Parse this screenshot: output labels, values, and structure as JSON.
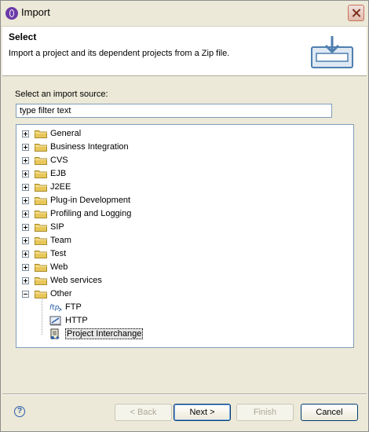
{
  "window": {
    "title": "Import"
  },
  "banner": {
    "heading": "Select",
    "description": "Import a project and its dependent projects from a Zip file."
  },
  "source": {
    "label": "Select an import source:",
    "filter_value": "type filter text"
  },
  "tree": {
    "items": [
      {
        "label": "General"
      },
      {
        "label": "Business Integration"
      },
      {
        "label": "CVS"
      },
      {
        "label": "EJB"
      },
      {
        "label": "J2EE"
      },
      {
        "label": "Plug-in Development"
      },
      {
        "label": "Profiling and Logging"
      },
      {
        "label": "SIP"
      },
      {
        "label": "Team"
      },
      {
        "label": "Test"
      },
      {
        "label": "Web"
      },
      {
        "label": "Web services"
      },
      {
        "label": "Other"
      }
    ],
    "other_children": [
      {
        "label": "FTP",
        "icon": "ftp-icon"
      },
      {
        "label": "HTTP",
        "icon": "http-icon"
      },
      {
        "label": "Project Interchange",
        "icon": "project-interchange-icon",
        "selected": true
      }
    ]
  },
  "buttons": {
    "help": "?",
    "back": "< Back",
    "next": "Next >",
    "finish": "Finish",
    "cancel": "Cancel"
  },
  "colors": {
    "folder": "#e8c75a",
    "dialog_bg": "#ece9d8",
    "border": "#7f9db9"
  }
}
